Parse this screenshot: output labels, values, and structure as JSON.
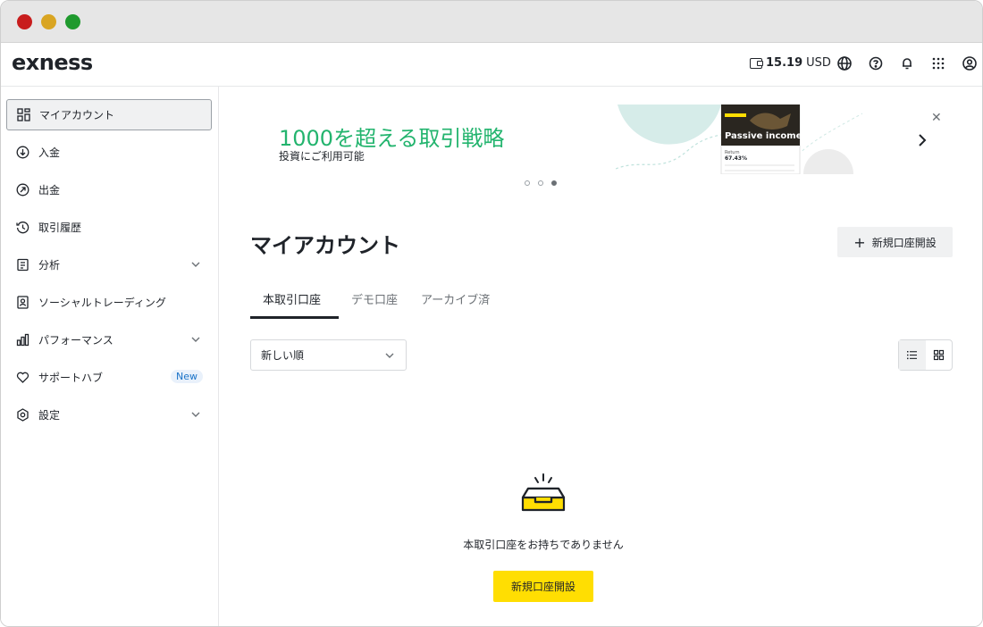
{
  "header": {
    "logo": "exness",
    "balance_amount": "15.19",
    "balance_currency": "USD",
    "icons": [
      "wallet-icon",
      "globe-icon",
      "help-icon",
      "bell-icon",
      "apps-grid-icon",
      "profile-icon"
    ]
  },
  "sidebar": {
    "items": [
      {
        "label": "マイアカウント",
        "icon": "dashboard-icon",
        "active": true
      },
      {
        "label": "入金",
        "icon": "deposit-icon"
      },
      {
        "label": "出金",
        "icon": "withdraw-icon"
      },
      {
        "label": "取引履歴",
        "icon": "history-icon"
      },
      {
        "label": "分析",
        "icon": "analytics-icon",
        "expandable": true
      },
      {
        "label": "ソーシャルトレーディング",
        "icon": "social-trading-icon"
      },
      {
        "label": "パフォーマンス",
        "icon": "performance-icon",
        "expandable": true
      },
      {
        "label": "サポートハブ",
        "icon": "heart-icon",
        "badge": "New"
      },
      {
        "label": "設定",
        "icon": "settings-icon",
        "expandable": true
      }
    ]
  },
  "banner": {
    "title": "1000を超える取引戦略",
    "subtitle": "投資にご利用可能",
    "card_title": "Passive income",
    "card_stat": "67.43%",
    "card_label": "Return",
    "slide_count": 3,
    "active_slide": 2
  },
  "main": {
    "page_title": "マイアカウント",
    "new_account_label": "新規口座開設",
    "tabs": [
      {
        "label": "本取引口座",
        "active": true
      },
      {
        "label": "デモ口座"
      },
      {
        "label": "アーカイブ済"
      }
    ],
    "sort_label": "新しい順",
    "empty_message": "本取引口座をお持ちでありません",
    "empty_cta": "新規口座開設"
  },
  "colors": {
    "accent_yellow": "#ffde02",
    "banner_green": "#23b46e",
    "badge_blue": "#1a73c8"
  }
}
